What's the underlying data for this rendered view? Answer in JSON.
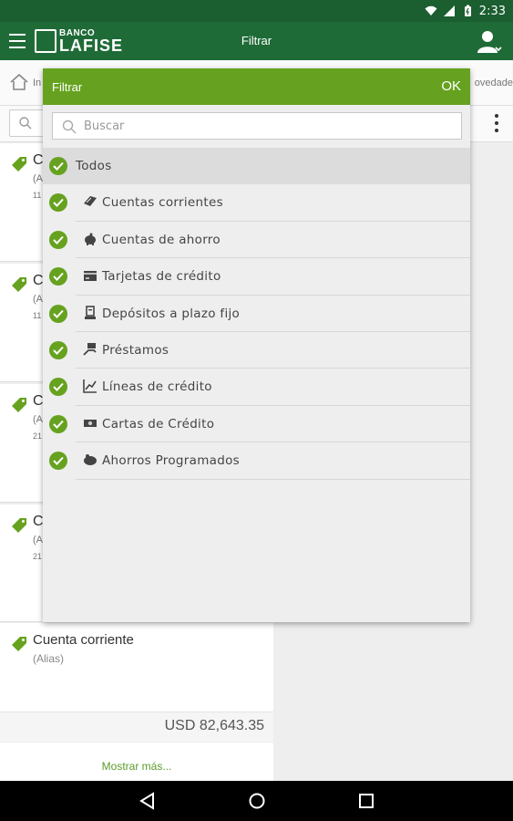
{
  "status": {
    "time": "2:33"
  },
  "app": {
    "logo_small": "BANCO",
    "logo_big": "LAFISE",
    "title": "Filtrar"
  },
  "crumbs": {
    "fragment": "In",
    "right_fragment": "ovedade"
  },
  "background_cards": [
    {
      "letter": "C",
      "sub": "(A",
      "num": "11"
    },
    {
      "letter": "C",
      "sub": "(A",
      "num": "11"
    },
    {
      "letter": "C",
      "sub": "(A",
      "num": "21"
    },
    {
      "letter": "C",
      "sub": "(A",
      "num": "21"
    }
  ],
  "account_card": {
    "title": "Cuenta corriente",
    "alias": "(Alias)",
    "amount": "USD 82,643.35"
  },
  "show_more": "Mostrar más...",
  "filter": {
    "title": "Filtrar",
    "ok": "OK",
    "search_placeholder": "Buscar",
    "all_label": "Todos",
    "items": [
      {
        "label": "Cuentas corrientes",
        "icon": "checkbook-icon"
      },
      {
        "label": "Cuentas de ahorro",
        "icon": "piggy-bank-icon"
      },
      {
        "label": "Tarjetas de crédito",
        "icon": "credit-card-icon"
      },
      {
        "label": "Depósitos a plazo fijo",
        "icon": "deposit-icon"
      },
      {
        "label": "Préstamos",
        "icon": "loan-icon"
      },
      {
        "label": "Líneas de crédito",
        "icon": "line-chart-icon"
      },
      {
        "label": "Cartas de Crédito",
        "icon": "banknote-icon"
      },
      {
        "label": "Ahorros Programados",
        "icon": "scheduled-savings-icon"
      }
    ]
  },
  "colors": {
    "app_bar": "#1f6b37",
    "status_bar": "#1b5e30",
    "accent_green": "#66a21f",
    "link_green": "#5a9a2a"
  }
}
